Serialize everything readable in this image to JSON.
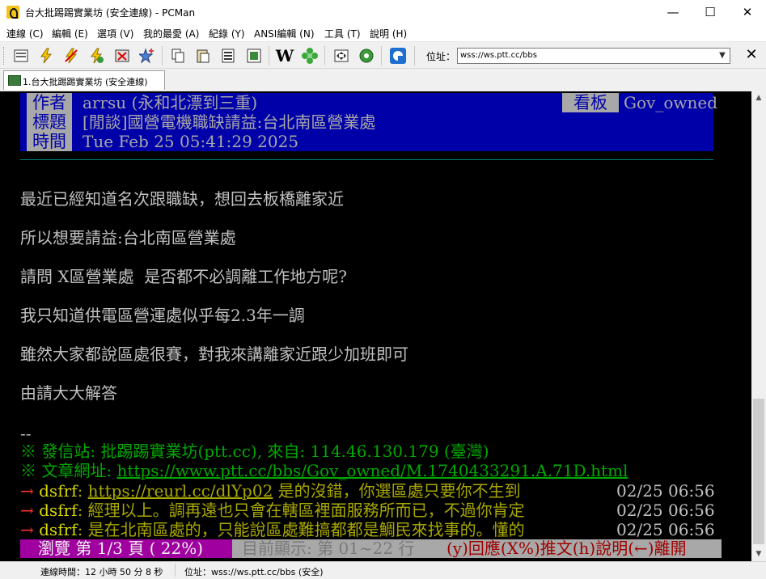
{
  "window": {
    "title": "台大批踢踢實業坊 (安全連線) - PCMan",
    "minimize": "—",
    "maximize": "☐",
    "close": "✕"
  },
  "menu": [
    {
      "label": "連線 (C)"
    },
    {
      "label": "編輯 (E)"
    },
    {
      "label": "選項 (V)"
    },
    {
      "label": "我的最愛 (A)"
    },
    {
      "label": "紀錄 (Y)"
    },
    {
      "label": "ANSI編輯 (N)"
    },
    {
      "label": "工具 (T)"
    },
    {
      "label": "說明 (H)"
    }
  ],
  "toolbar": {
    "address_label": "位址：",
    "address_value": "wss://ws.ptt.cc/bbs",
    "close_glyph": "✕"
  },
  "tab": {
    "label": "1.台大批踢踢實業坊 (安全連線)"
  },
  "article": {
    "header": {
      "author_label": "作者",
      "author": "arrsu (永和北漂到三重)",
      "board_label": "看板",
      "board": "Gov_owned",
      "title_label": "標題",
      "title": "[閒談]國營電機職缺請益:台北南區營業處",
      "time_label": "時間",
      "time": "Tue Feb 25 05:41:29 2025"
    },
    "body": [
      "最近已經知道名次跟職缺，想回去板橋離家近",
      "所以想要請益:台北南區營業處",
      "請問 X區營業處  是否都不必調離工作地方呢?",
      "我只知道供電區營運處似乎每2.3年一調",
      "雖然大家都說區處很賽，對我來講離家近跟少加班即可",
      "由請大大解答"
    ],
    "signature_sep": "--",
    "origin_prefix": "※ 發信站: 批踢踢實業坊(ptt.cc), 來自: 114.46.130.179 (臺灣)",
    "url_prefix": "※ 文章網址: ",
    "url": "https://www.ptt.cc/bbs/Gov_owned/M.1740433291.A.71D.html",
    "pushes": [
      {
        "tag": "→",
        "user": "dsfrf",
        "sep": ": ",
        "link": "https://reurl.cc/dlYp02",
        "content": " 是的沒錯，你選區處只要你不生到",
        "time": "02/25 06:56"
      },
      {
        "tag": "→",
        "user": "dsfrf",
        "sep": ": ",
        "link": "",
        "content": "經理以上。調再遠也只會在轄區裡面服務所而已，不過你肯定",
        "time": "02/25 06:56"
      },
      {
        "tag": "→",
        "user": "dsfrf",
        "sep": ": ",
        "link": "",
        "content": "是在北南區處的，只能說區處難搞都都是鯛民來找事的。懂的",
        "time": "02/25 06:56"
      }
    ]
  },
  "statusbar": {
    "page": "瀏覽 第 1/3 頁 ( 22%)",
    "showing": "目前顯示: 第 01~22 行",
    "keys": "(y)回應(X%)推文(h)說明(←)離開"
  },
  "bottom": {
    "connection_time": "連線時間：12 小時 50 分 8 秒",
    "address": "位址：wss://ws.ptt.cc/bbs (安全)"
  },
  "colors": {
    "header_bg": "#0000a8",
    "page_bar_bg": "#a000a0",
    "push_arrow": "#ff3030",
    "push_user": "#d8d800",
    "origin_text": "#00a800"
  },
  "icons": [
    "app-logo-icon",
    "new-connection-icon",
    "quick-connect-icon",
    "disconnect-icon",
    "reconnect-icon",
    "close-connection-icon",
    "favorite-add-icon",
    "copy-icon",
    "paste-icon",
    "copy-article-icon",
    "screenshot-icon",
    "wikipedia-icon",
    "options-flower-icon",
    "fullscreen-icon",
    "settings-gear-icon",
    "pcman-logo-icon",
    "tab-terminal-icon"
  ]
}
